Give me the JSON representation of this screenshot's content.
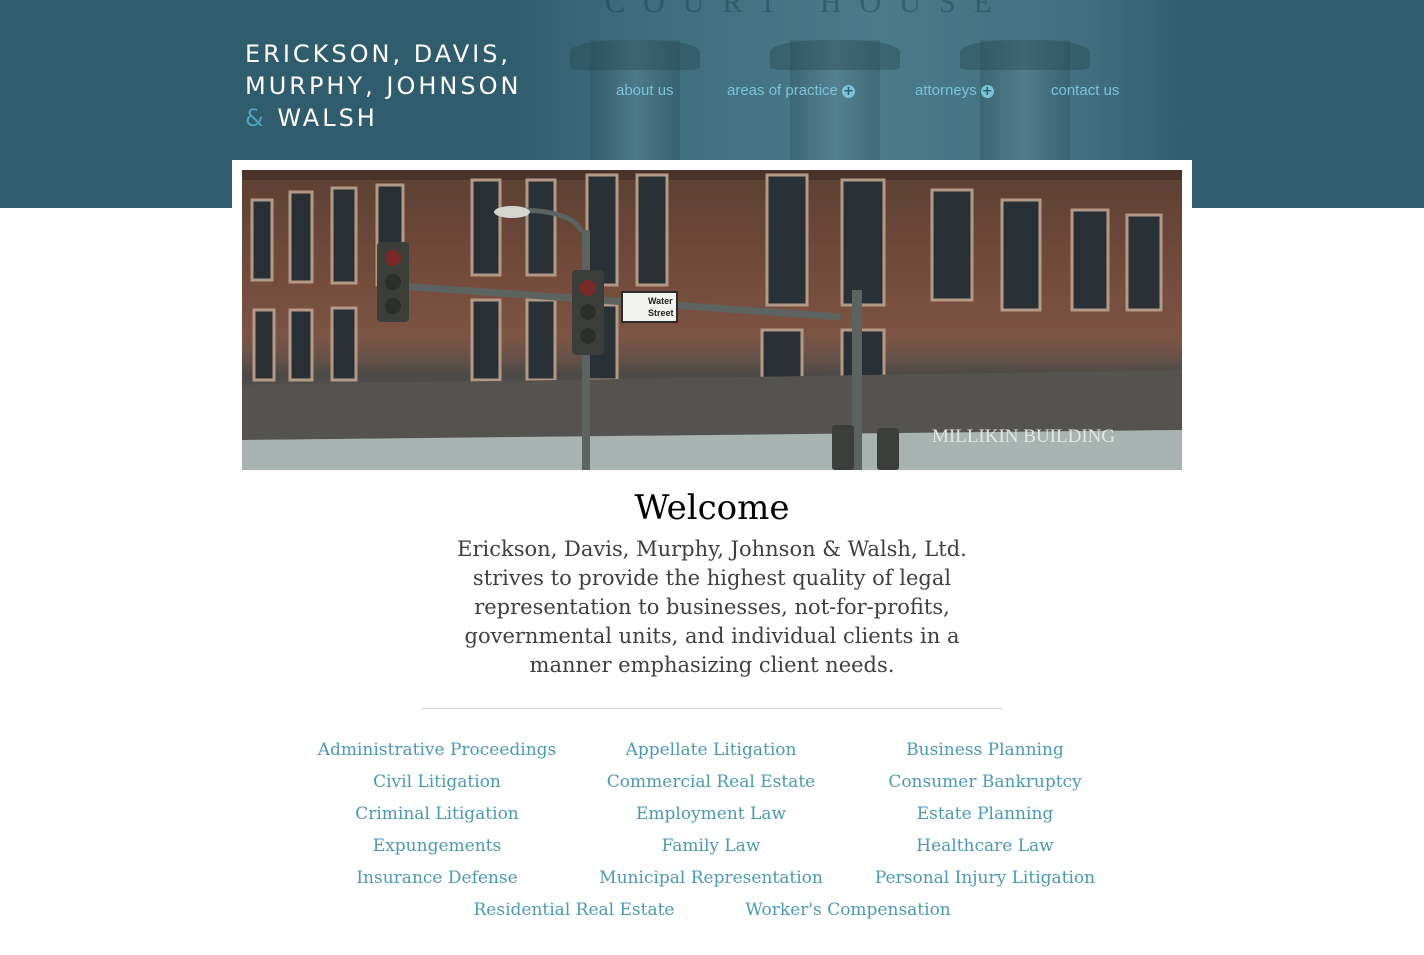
{
  "firm": {
    "name_line1": "ERICKSON, DAVIS,",
    "name_line2": "MURPHY, JOHNSON",
    "name_amp": "&",
    "name_line3": "WALSH"
  },
  "header_engraving": "COURT HOUSE",
  "nav": {
    "about": "about us",
    "practice": "areas of practice",
    "attorneys": "attorneys",
    "contact": "contact us",
    "expand_glyph": "+"
  },
  "hero": {
    "street_sign_line1": "Water",
    "street_sign_line2": "Street",
    "building_sign": "MILLIKIN BUILDING"
  },
  "welcome": {
    "title": "Welcome",
    "line1": "Erickson, Davis, Murphy, Johnson & Walsh, Ltd.",
    "line2": "strives to provide the highest quality of legal",
    "line3": "representation to businesses, not-for-profits,",
    "line4": "governmental units, and individual clients in a",
    "line5": "manner emphasizing client needs."
  },
  "practice_areas": [
    "Administrative Proceedings",
    "Appellate Litigation",
    "Business Planning",
    "Civil Litigation",
    "Commercial Real Estate",
    "Consumer Bankruptcy",
    "Criminal Litigation",
    "Employment Law",
    "Estate Planning",
    "Expungements",
    "Family Law",
    "Healthcare Law",
    "Insurance Defense",
    "Municipal Representation",
    "Personal Injury Litigation",
    "Residential Real Estate",
    "Worker's Compensation"
  ],
  "colors": {
    "header": "#305d6e",
    "accent": "#4da3c0",
    "nav_text": "#7cc4db",
    "link": "#4a9ab5"
  }
}
